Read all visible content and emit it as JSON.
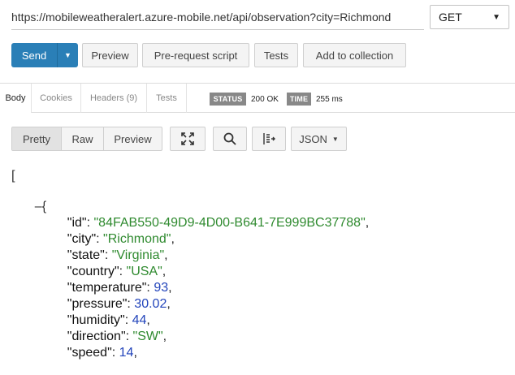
{
  "request": {
    "url": "https://mobileweatheralert.azure-mobile.net/api/observation?city=Richmond",
    "method": "GET"
  },
  "actions": {
    "send": "Send",
    "preview": "Preview",
    "prerequest": "Pre-request script",
    "tests": "Tests",
    "add_to_collection": "Add to collection"
  },
  "response_tabs": {
    "body": "Body",
    "cookies": "Cookies",
    "headers": "Headers (9)",
    "tests": "Tests"
  },
  "status": {
    "status_label": "STATUS",
    "status_value": "200 OK",
    "time_label": "TIME",
    "time_value": "255 ms"
  },
  "viewer": {
    "pretty": "Pretty",
    "raw": "Raw",
    "preview": "Preview",
    "format": "JSON"
  },
  "json": {
    "open_bracket": "[",
    "collapse_symbol": "–",
    "open_brace": "{",
    "fields": [
      {
        "key": "id",
        "value": "\"84FAB550-49D9-4D00-B641-7E999BC37788\"",
        "type": "str"
      },
      {
        "key": "city",
        "value": "\"Richmond\"",
        "type": "str"
      },
      {
        "key": "state",
        "value": "\"Virginia\"",
        "type": "str"
      },
      {
        "key": "country",
        "value": "\"USA\"",
        "type": "str"
      },
      {
        "key": "temperature",
        "value": "93",
        "type": "num"
      },
      {
        "key": "pressure",
        "value": "30.02",
        "type": "num"
      },
      {
        "key": "humidity",
        "value": "44",
        "type": "num"
      },
      {
        "key": "direction",
        "value": "\"SW\"",
        "type": "str"
      },
      {
        "key": "speed",
        "value": "14",
        "type": "num"
      }
    ]
  },
  "icons": {
    "expand": "expand-icon",
    "search": "search-icon",
    "wrap": "wrap-lines-icon",
    "caret": "caret-down-icon"
  },
  "colors": {
    "send_button": "#2a7fb7",
    "string_value": "#2f8a2f",
    "number_value": "#2244bb",
    "badge": "#888888"
  }
}
